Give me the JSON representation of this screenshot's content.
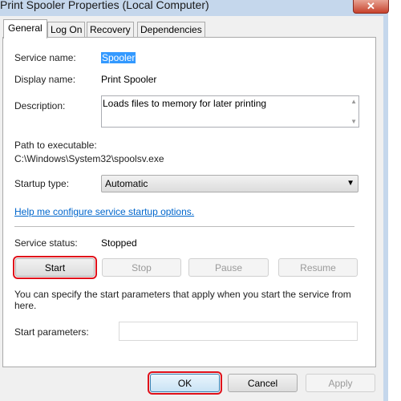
{
  "window": {
    "title": "Print Spooler Properties (Local Computer)",
    "close_icon": "close-icon"
  },
  "tabs": [
    {
      "label": "General",
      "active": true
    },
    {
      "label": "Log On"
    },
    {
      "label": "Recovery"
    },
    {
      "label": "Dependencies"
    }
  ],
  "general": {
    "service_name_label": "Service name:",
    "service_name": "Spooler",
    "display_name_label": "Display name:",
    "display_name": "Print Spooler",
    "description_label": "Description:",
    "description": "Loads files to memory for later printing",
    "path_label": "Path to executable:",
    "path": "C:\\Windows\\System32\\spoolsv.exe",
    "startup_type_label": "Startup type:",
    "startup_type": "Automatic",
    "help_link": "Help me configure service startup options.",
    "service_status_label": "Service status:",
    "service_status": "Stopped",
    "buttons": {
      "start": "Start",
      "stop": "Stop",
      "pause": "Pause",
      "resume": "Resume"
    },
    "params_hint": "You can specify the start parameters that apply when you start the service from here.",
    "start_params_label": "Start parameters:",
    "start_params_value": ""
  },
  "footer": {
    "ok": "OK",
    "cancel": "Cancel",
    "apply": "Apply"
  },
  "colors": {
    "highlight": "#e0101a",
    "link": "#0066cc",
    "selection": "#3399ff"
  }
}
